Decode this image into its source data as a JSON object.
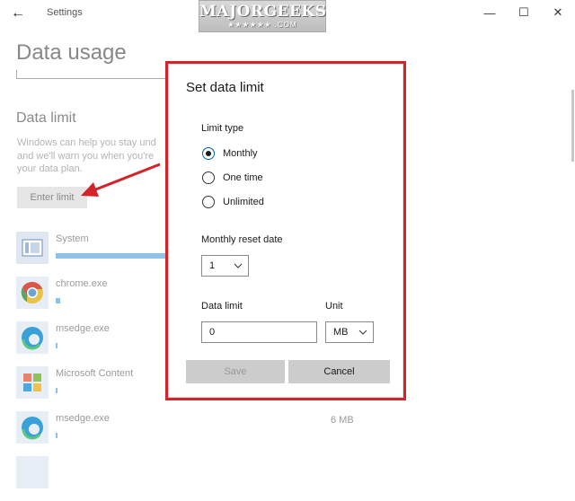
{
  "window": {
    "title": "Settings",
    "back_icon": "←",
    "minimize_icon": "—",
    "maximize_icon": "☐",
    "close_icon": "✕"
  },
  "watermark": {
    "text": "MAJORGEEKS",
    "subtext": "★★★★★★ .COM"
  },
  "page": {
    "title": "Data usage",
    "section_heading": "Data limit",
    "description_lines": [
      "Windows can help you stay und",
      "and we'll warn you when you're",
      "your data plan."
    ],
    "enter_limit_label": "Enter limit"
  },
  "apps": [
    {
      "name": "System",
      "size": "",
      "usage_fraction": 1.0,
      "icon": "system-icon"
    },
    {
      "name": "chrome.exe",
      "size": "",
      "usage_fraction": 0.03,
      "icon": "chrome-icon"
    },
    {
      "name": "msedge.exe",
      "size": "",
      "usage_fraction": 0.01,
      "icon": "edge-icon"
    },
    {
      "name": "Microsoft Content",
      "size": "",
      "usage_fraction": 0.01,
      "icon": "microsoft-icon"
    },
    {
      "name": "msedge.exe",
      "size": "6 MB",
      "usage_fraction": 0.01,
      "icon": "edge-icon"
    }
  ],
  "dialog": {
    "title": "Set data limit",
    "limit_type_label": "Limit type",
    "options": [
      "Monthly",
      "One time",
      "Unlimited"
    ],
    "selected_option": "Monthly",
    "reset_date_label": "Monthly reset date",
    "reset_date_value": "1",
    "data_limit_label": "Data limit",
    "data_limit_value": "0",
    "unit_label": "Unit",
    "unit_value": "MB",
    "save_label": "Save",
    "cancel_label": "Cancel"
  },
  "colors": {
    "highlight_border": "#d5232a",
    "accent": "#0063b1",
    "usage_bar": "#8ec3e8"
  }
}
